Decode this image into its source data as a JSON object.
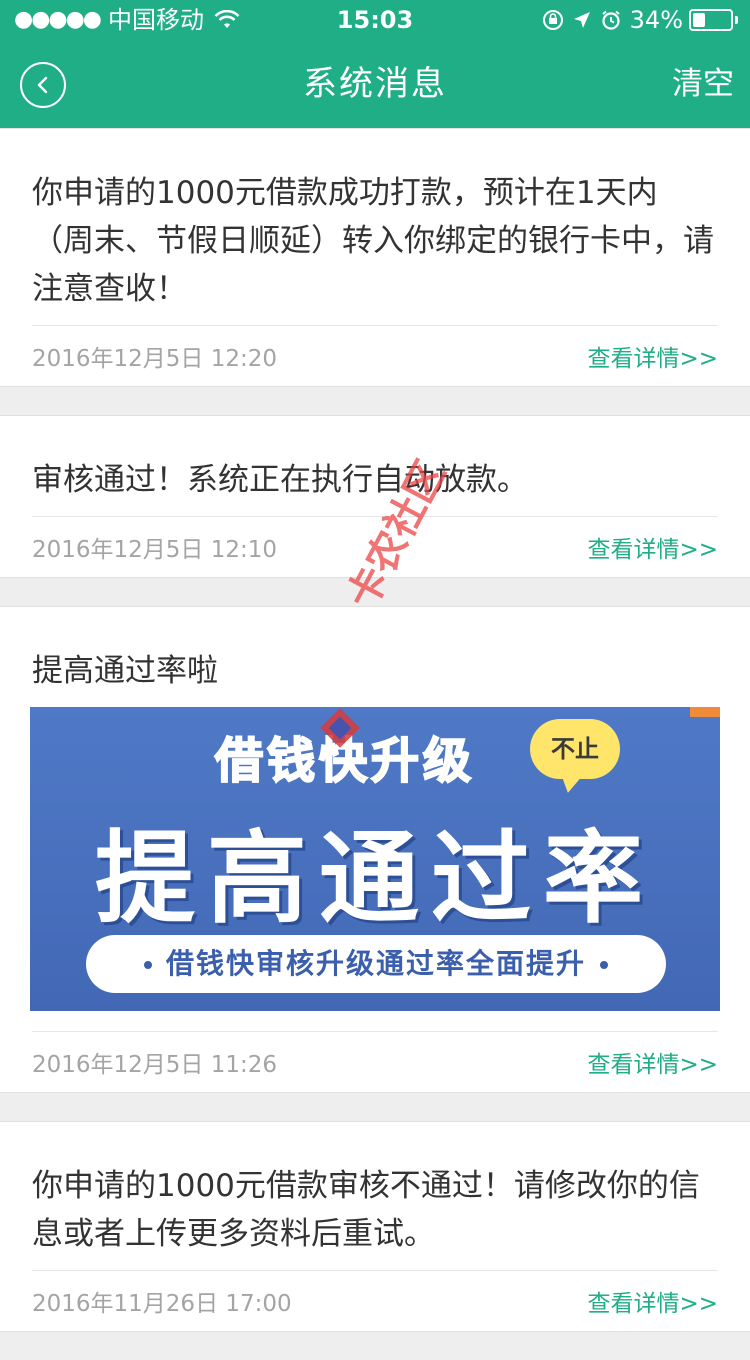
{
  "status_bar": {
    "signal": "●●●●●",
    "carrier": "中国移动",
    "time": "15:03",
    "battery": "34%",
    "battery_level": 0.34
  },
  "nav": {
    "title": "系统消息",
    "clear": "清空"
  },
  "messages": [
    {
      "text": "你申请的1000元借款成功打款，预计在1天内（周末、节假日顺延）转入你绑定的银行卡中，请注意查收！",
      "date": "2016年12月5日 12:20",
      "detail": "查看详情>>"
    },
    {
      "text": "审核通过！系统正在执行自动放款。",
      "date": "2016年12月5日 12:10",
      "detail": "查看详情>>"
    },
    {
      "text": "提高通过率啦",
      "date": "2016年12月5日 11:26",
      "detail": "查看详情>>",
      "banner": {
        "top": "借钱快升级",
        "bubble": "不止",
        "main": "提高通过率",
        "pill": "借钱快审核升级通过率全面提升"
      }
    },
    {
      "text": "你申请的1000元借款审核不通过！请修改你的信息或者上传更多资料后重试。",
      "date": "2016年11月26日 17:00",
      "detail": "查看详情>>"
    }
  ],
  "watermark": "卡农社区",
  "colors": {
    "primary": "#1fae86",
    "background": "#eeeeee",
    "date": "#a4a4a4"
  }
}
